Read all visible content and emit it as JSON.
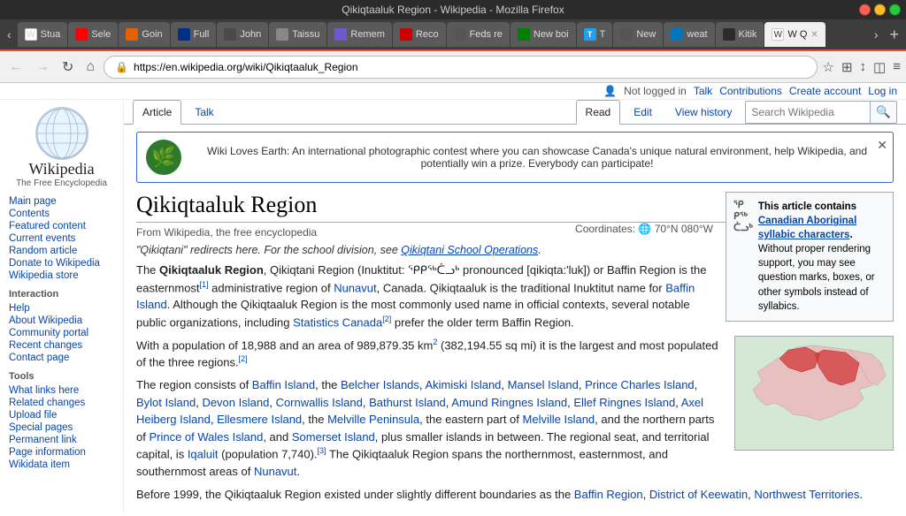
{
  "window": {
    "title": "Qikiqtaaluk Region - Wikipedia - Mozilla Firefox"
  },
  "tabs": [
    {
      "id": "stua",
      "label": "Stua",
      "fav_class": "fav-wiki",
      "fav_text": "W",
      "active": false
    },
    {
      "id": "sele",
      "label": "Sele",
      "fav_class": "fav-youtube",
      "fav_text": "",
      "active": false
    },
    {
      "id": "goin",
      "label": "Goin",
      "fav_class": "fav-mozilla",
      "fav_text": "",
      "active": false
    },
    {
      "id": "full",
      "label": "Full",
      "fav_class": "fav-metro",
      "fav_text": "",
      "active": false
    },
    {
      "id": "john",
      "label": "John",
      "fav_class": "fav-john",
      "fav_text": "",
      "active": false
    },
    {
      "id": "taiss",
      "label": "Taissu",
      "fav_class": "fav-taiss",
      "fav_text": "",
      "active": false
    },
    {
      "id": "remem",
      "label": "Remem",
      "fav_class": "fav-remem",
      "fav_text": "",
      "active": false
    },
    {
      "id": "reco",
      "label": "Reco",
      "fav_class": "fav-rec",
      "fav_text": "",
      "active": false
    },
    {
      "id": "feds",
      "label": "Feds re",
      "fav_class": "fav-feds",
      "fav_text": "",
      "active": false
    },
    {
      "id": "newbo",
      "label": "New boi",
      "fav_class": "fav-newbo",
      "fav_text": "",
      "active": false
    },
    {
      "id": "t",
      "label": "T",
      "fav_class": "fav-t",
      "fav_text": "T",
      "active": false
    },
    {
      "id": "new",
      "label": "New",
      "fav_class": "fav-new",
      "fav_text": "",
      "active": false
    },
    {
      "id": "weather",
      "label": "weat",
      "fav_class": "fav-weather",
      "fav_text": "",
      "active": false
    },
    {
      "id": "kitab",
      "label": "Kitik",
      "fav_class": "fav-kitab",
      "fav_text": "",
      "active": false
    },
    {
      "id": "wq",
      "label": "W Q",
      "fav_class": "fav-wq",
      "fav_text": "W",
      "active": true
    }
  ],
  "address_bar": {
    "url": "https://en.wikipedia.org/wiki/Qikiqtaaluk_Region",
    "lock_icon": "🔒"
  },
  "user_bar": {
    "not_logged_in": "Not logged in",
    "talk": "Talk",
    "contributions": "Contributions",
    "create_account": "Create account",
    "log_in": "Log in"
  },
  "sidebar": {
    "logo_text": "🌐",
    "wordmark": "Wikipedia",
    "tagline": "The Free Encyclopedia",
    "navigation": {
      "title": "",
      "items": [
        {
          "label": "Main page"
        },
        {
          "label": "Contents"
        },
        {
          "label": "Featured content"
        },
        {
          "label": "Current events"
        },
        {
          "label": "Random article"
        },
        {
          "label": "Donate to Wikipedia"
        },
        {
          "label": "Wikipedia store"
        }
      ]
    },
    "interaction": {
      "title": "Interaction",
      "items": [
        {
          "label": "Help"
        },
        {
          "label": "About Wikipedia"
        },
        {
          "label": "Community portal"
        },
        {
          "label": "Recent changes"
        },
        {
          "label": "Contact page"
        }
      ]
    },
    "tools": {
      "title": "Tools",
      "items": [
        {
          "label": "What links here"
        },
        {
          "label": "Related changes"
        },
        {
          "label": "Upload file"
        },
        {
          "label": "Special pages"
        },
        {
          "label": "Permanent link"
        },
        {
          "label": "Page information"
        },
        {
          "label": "Wikidata item"
        }
      ]
    }
  },
  "article_tabs": {
    "left": [
      {
        "label": "Article",
        "active": true
      },
      {
        "label": "Talk",
        "active": false
      }
    ],
    "right": [
      {
        "label": "Read",
        "active": true
      },
      {
        "label": "Edit",
        "active": false
      },
      {
        "label": "View history",
        "active": false
      }
    ]
  },
  "search": {
    "placeholder": "Search Wikipedia"
  },
  "banner": {
    "text": "Wiki Loves Earth: An international photographic contest where you can showcase Canada's unique natural environment, help Wikipedia, and potentially win a prize. Everybody can participate!"
  },
  "article": {
    "title": "Qikiqtaaluk Region",
    "subtitle": "From Wikipedia, the free encyclopedia",
    "coordinates": "Coordinates: 🌐 70°N 080°W",
    "italic_note": "\"Qikiqtani\" redirects here. For the school division, see Qikiqtani School Operations.",
    "infobox": {
      "title": "This article contains Canadian Aboriginal syllabic characters.",
      "body": "Without proper rendering support, you may see question marks, boxes, or other symbols instead of syllabics."
    },
    "paragraphs": [
      "The Qikiqtaaluk Region, Qikiqtani Region (Inuktitut: ᕿᑭᖅᑖᓗᒃ pronounced [qikiqta:'luk]) or Baffin Region is the easternmost[1] administrative region of Nunavut, Canada. Qikiqtaaluk is the traditional Inuktitut name for Baffin Island. Although the Qikiqtaaluk Region is the most commonly used name in official contexts, several notable public organizations, including Statistics Canada[2] prefer the older term Baffin Region.",
      "With a population of 18,988 and an area of 989,879.35 km² (382,194.55 sq mi) it is the largest and most populated of the three regions.[2]",
      "The region consists of Baffin Island, the Belcher Islands, Akimiski Island, Mansel Island, Prince Charles Island, Bylot Island, Devon Island, Cornwallis Island, Bathurst Island, Amund Ringnes Island, Ellef Ringnes Island, Axel Heiberg Island, Ellesmere Island, the Melville Peninsula, the eastern part of Melville Island, and the northern parts of Prince of Wales Island, and Somerset Island, plus smaller islands in between. The regional seat, and territorial capital, is Iqaluit (population 7,740).[3] The Qikiqtaaluk Region spans the northernmost, easternmost, and southernmost areas of Nunavut.",
      "Before 1999, the Qikiqtaaluk Region existed under slightly different boundaries as the Baffin Region, District of Keewatin, Northwest Territories."
    ]
  }
}
